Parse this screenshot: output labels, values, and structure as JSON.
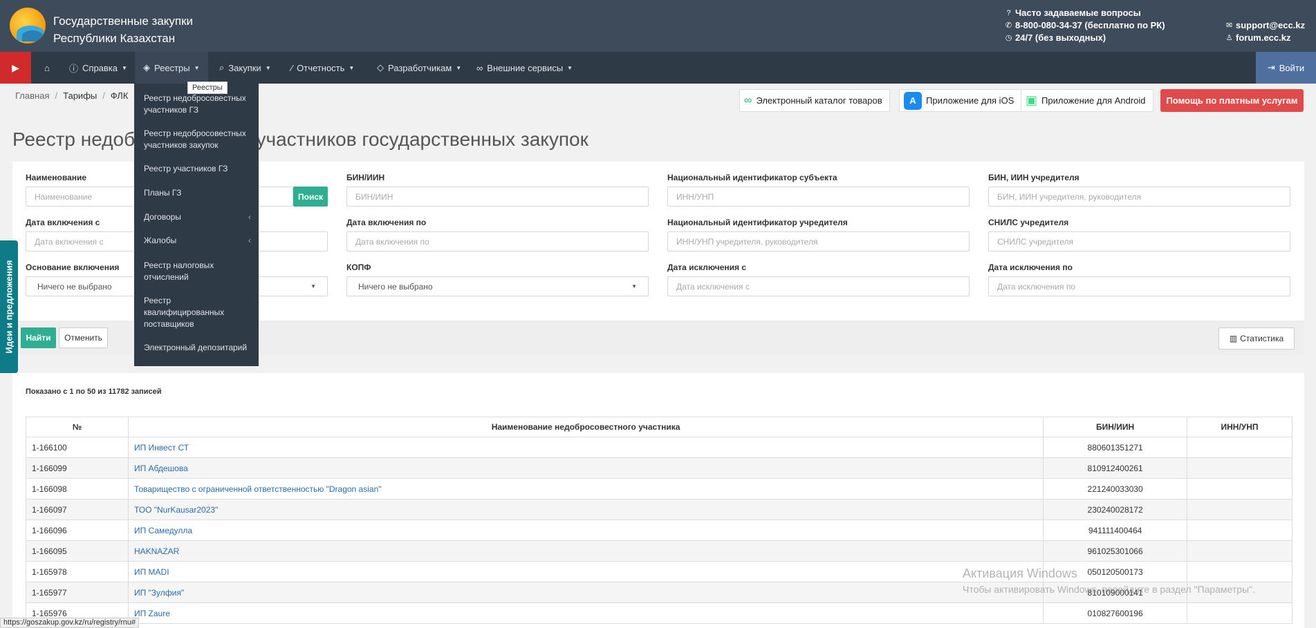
{
  "header": {
    "title_line1": "Государственные закупки",
    "title_line2": "Республики Казахстан",
    "faq": "Часто задаваемые вопросы",
    "phone": "8-800-080-34-37 (бесплатно по РК)",
    "hours": "24/7 (без выходных)",
    "email": "support@ecc.kz",
    "forum": "forum.ecc.kz"
  },
  "navbar": {
    "items": [
      {
        "label": "Справка"
      },
      {
        "label": "Реестры"
      },
      {
        "label": "Закупки"
      },
      {
        "label": "Отчетность"
      },
      {
        "label": "Разработчикам"
      },
      {
        "label": "Внешние сервисы"
      }
    ],
    "login": "Войти"
  },
  "tooltip": "Реестры",
  "dropdown": {
    "items": [
      {
        "label": "Реестр недобросовестных участников ГЗ"
      },
      {
        "label": "Реестр недобросовестных участников закупок"
      },
      {
        "label": "Реестр участников ГЗ"
      },
      {
        "label": "Планы ГЗ"
      },
      {
        "label": "Договоры"
      },
      {
        "label": "Жалобы"
      },
      {
        "label": "Реестр налоговых отчислений"
      },
      {
        "label": "Реестр квалифицированных поставщиков"
      },
      {
        "label": "Электронный депозитарий"
      }
    ]
  },
  "breadcrumb": [
    "Главная",
    "Тарифы",
    "ФЛК"
  ],
  "top_buttons": {
    "catalog": "Электронный каталог товаров",
    "ios": "Приложение для iOS",
    "android": "Приложение для Android",
    "help": "Помощь по платным услугам"
  },
  "page_title": "Реестр недобросовестных участников государственных закупок",
  "filters": {
    "name_label": "Наименование",
    "name_placeholder": "Наименование",
    "search_btn": "Поиск",
    "bin_label": "БИН/ИИН",
    "bin_placeholder": "БИН/ИИН",
    "nat_id_label": "Национальный идентификатор субъекта",
    "nat_id_placeholder": "ИНН/УНП",
    "founder_bin_label": "БИН, ИИН учредителя",
    "founder_bin_placeholder": "БИН, ИИН учредителя, руководителя",
    "date_from_label": "Дата включения с",
    "date_from_placeholder": "Дата включения с",
    "date_to_label": "Дата включения по",
    "date_to_placeholder": "Дата включения по",
    "founder_nat_id_label": "Национальный идентификатор учредителя",
    "founder_nat_id_placeholder": "ИНН/УНП учредителя, руководителя",
    "snils_label": "СНИЛС учредителя",
    "snils_placeholder": "СНИЛС учредителя",
    "basis_label": "Основание включения",
    "basis_value": "Ничего не выбрано",
    "kopf_label": "КОПФ",
    "kopf_value": "Ничего не выбрано",
    "excl_from_label": "Дата исключения с",
    "excl_from_placeholder": "Дата исключения с",
    "excl_to_label": "Дата исключения по",
    "excl_to_placeholder": "Дата исключения по"
  },
  "actions": {
    "find": "Найти",
    "cancel": "Отменить",
    "stats": "Статистика"
  },
  "results_info": "Показано с 1 по 50 из 11782 записей",
  "table": {
    "headers": [
      "№",
      "Наименование недобросовестного участника",
      "БИН/ИИН",
      "ИНН/УНП"
    ],
    "rows": [
      [
        "1-166100",
        "ИП Инвест СТ",
        "880601351271",
        ""
      ],
      [
        "1-166099",
        "ИП Абдешова",
        "810912400261",
        ""
      ],
      [
        "1-166098",
        "Товарищество с ограниченной ответственностью \"Dragon asian\"",
        "221240033030",
        ""
      ],
      [
        "1-166097",
        "ТОО \"NurKausar2023\"",
        "230240028172",
        ""
      ],
      [
        "1-166096",
        "ИП Самедулла",
        "941111400464",
        ""
      ],
      [
        "1-166095",
        "HAKNAZAR",
        "961025301066",
        ""
      ],
      [
        "1-165978",
        "ИП MADI",
        "050120500173",
        ""
      ],
      [
        "1-165977",
        "ИП \"Зулфия\"",
        "810109000141",
        ""
      ],
      [
        "1-165976",
        "ИП Zaure",
        "010827600196",
        ""
      ]
    ]
  },
  "side_tab": "Идеи и предложения",
  "watermark": {
    "line1": "Активация Windows",
    "line2": "Чтобы активировать Windows, перейдите в раздел \"Параметры\"."
  },
  "status_url": "https://goszakup.gov.kz/ru/registry/rnu#"
}
